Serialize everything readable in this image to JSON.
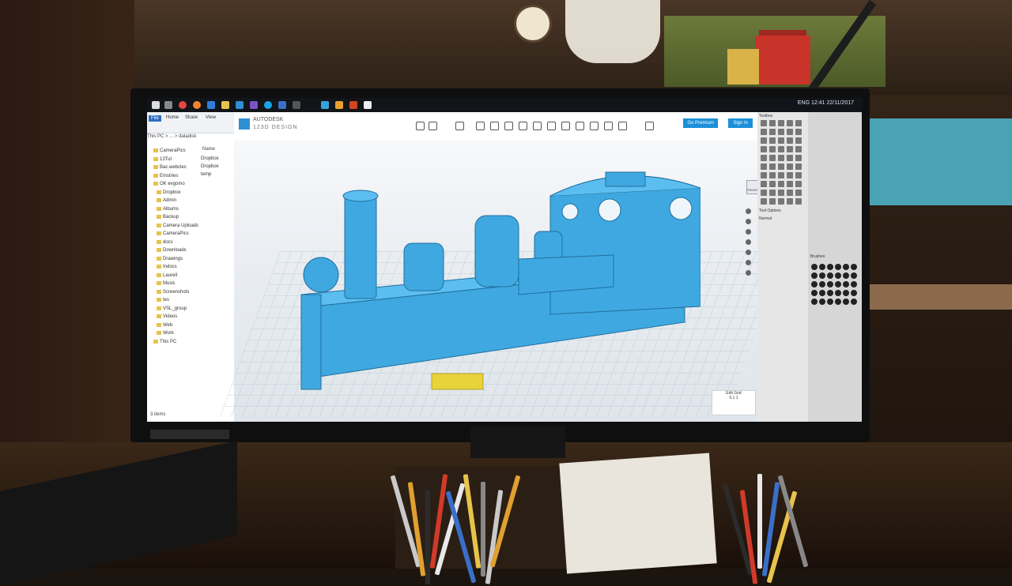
{
  "scene": {
    "description_colors": {
      "model": "#3fa8e0",
      "highlight": "#e8d33c",
      "accent": "#1b8fd8"
    }
  },
  "taskbar": {
    "clock_time": "12:41",
    "clock_date": "22/11/2017",
    "language": "ENG"
  },
  "explorer": {
    "tabs": [
      "File",
      "Home",
      "Share",
      "View"
    ],
    "path": "This PC > ... > datadisk",
    "items": [
      "CameraPics",
      "13Tut",
      "Bac.webcles",
      "Emstries",
      "OK evgomo",
      "Dropbox",
      "Admin",
      "Albums",
      "Backup",
      "Camera Uploads",
      "CameraPics",
      "docs",
      "Downloads",
      "Drawings",
      "Indocs",
      "Laurell",
      "Music",
      "Screenshots",
      "tes",
      "VSL_group",
      "Videos",
      "Web",
      "Work",
      "This PC"
    ],
    "column_header": "Name",
    "right_items": [
      "Dropbox",
      "Dropbox",
      "temp"
    ],
    "status": "3 items"
  },
  "app": {
    "brand": "AUTODESK",
    "name": "123D DESIGN",
    "premium_label": "Go Premium",
    "signin_label": "Sign In",
    "view_label": "FRONT",
    "edit_grid_label": "Edit Grid",
    "edit_grid_values": [
      "0.1",
      "1"
    ]
  },
  "gimp": {
    "tabs": [
      "Toolbox",
      "Tool Options"
    ],
    "mode": "Normal",
    "panel_label": "Brushes"
  }
}
